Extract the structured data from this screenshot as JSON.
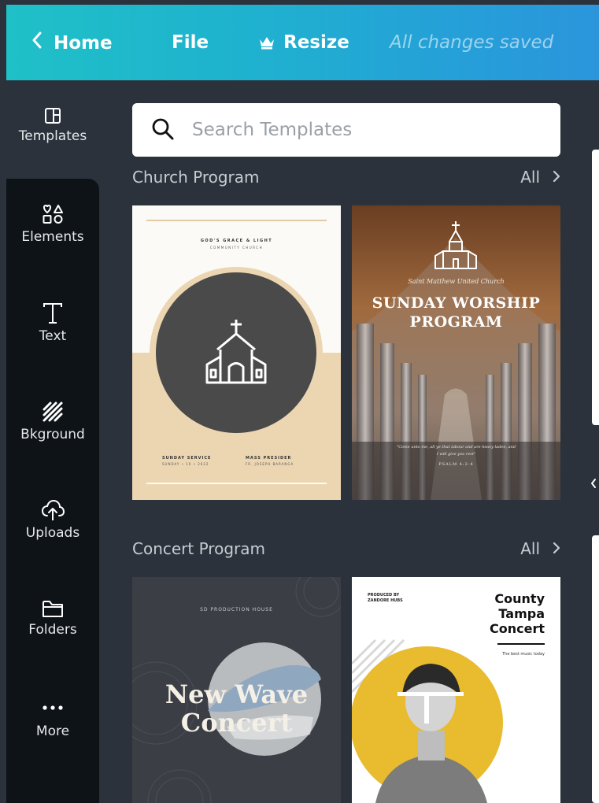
{
  "topbar": {
    "home_label": "Home",
    "file_label": "File",
    "resize_label": "Resize",
    "status": "All changes saved"
  },
  "sidebar": {
    "items": [
      {
        "label": "Templates",
        "icon": "templates-icon",
        "active": true
      },
      {
        "label": "Elements",
        "icon": "elements-icon"
      },
      {
        "label": "Text",
        "icon": "text-icon"
      },
      {
        "label": "Bkground",
        "icon": "background-icon"
      },
      {
        "label": "Uploads",
        "icon": "upload-icon"
      },
      {
        "label": "Folders",
        "icon": "folder-icon"
      },
      {
        "label": "More",
        "icon": "more-icon"
      }
    ]
  },
  "search": {
    "placeholder": "Search Templates",
    "value": ""
  },
  "sections": [
    {
      "title": "Church Program",
      "all_label": "All",
      "templates": [
        {
          "line1": "GOD'S GRACE & LIGHT",
          "line2": "COMMUNITY CHURCH",
          "footer_left_title": "SUNDAY SERVICE",
          "footer_left_sub": "SUNDAY • 10 • 2022",
          "footer_right_title": "MASS PRESIDER",
          "footer_right_sub": "FR. JOSEPH BARANGA"
        },
        {
          "subtitle": "Saint Matthew United Church",
          "title_line1": "SUNDAY WORSHIP",
          "title_line2": "PROGRAM",
          "quote_line1": "\"Come unto me, all ye that labour and are heavy laden, and",
          "quote_line2": "I will give you rest\"",
          "reference": "PSALM 4:2-4"
        }
      ]
    },
    {
      "title": "Concert Program",
      "all_label": "All",
      "templates": [
        {
          "top_text": "SD PRODUCTION HOUSE",
          "title_line1": "New Wave",
          "title_line2": "Concert"
        },
        {
          "produced_line1": "PRODUCED BY",
          "produced_line2": "ZANDORE HUBS",
          "title_line1": "County",
          "title_line2": "Tampa",
          "title_line3": "Concert",
          "tagline": "The best music today"
        }
      ]
    }
  ],
  "colors": {
    "topbar_gradient_start": "#1fc0c7",
    "topbar_gradient_end": "#2b95dc",
    "panel_bg": "#2b323c",
    "sidebar_bg": "#0e1318",
    "church_beige": "#ecd6b2",
    "church_circle": "#4a4a4a",
    "concert_yellow": "#e9bb2e",
    "concert_dark": "#3b3e44"
  }
}
